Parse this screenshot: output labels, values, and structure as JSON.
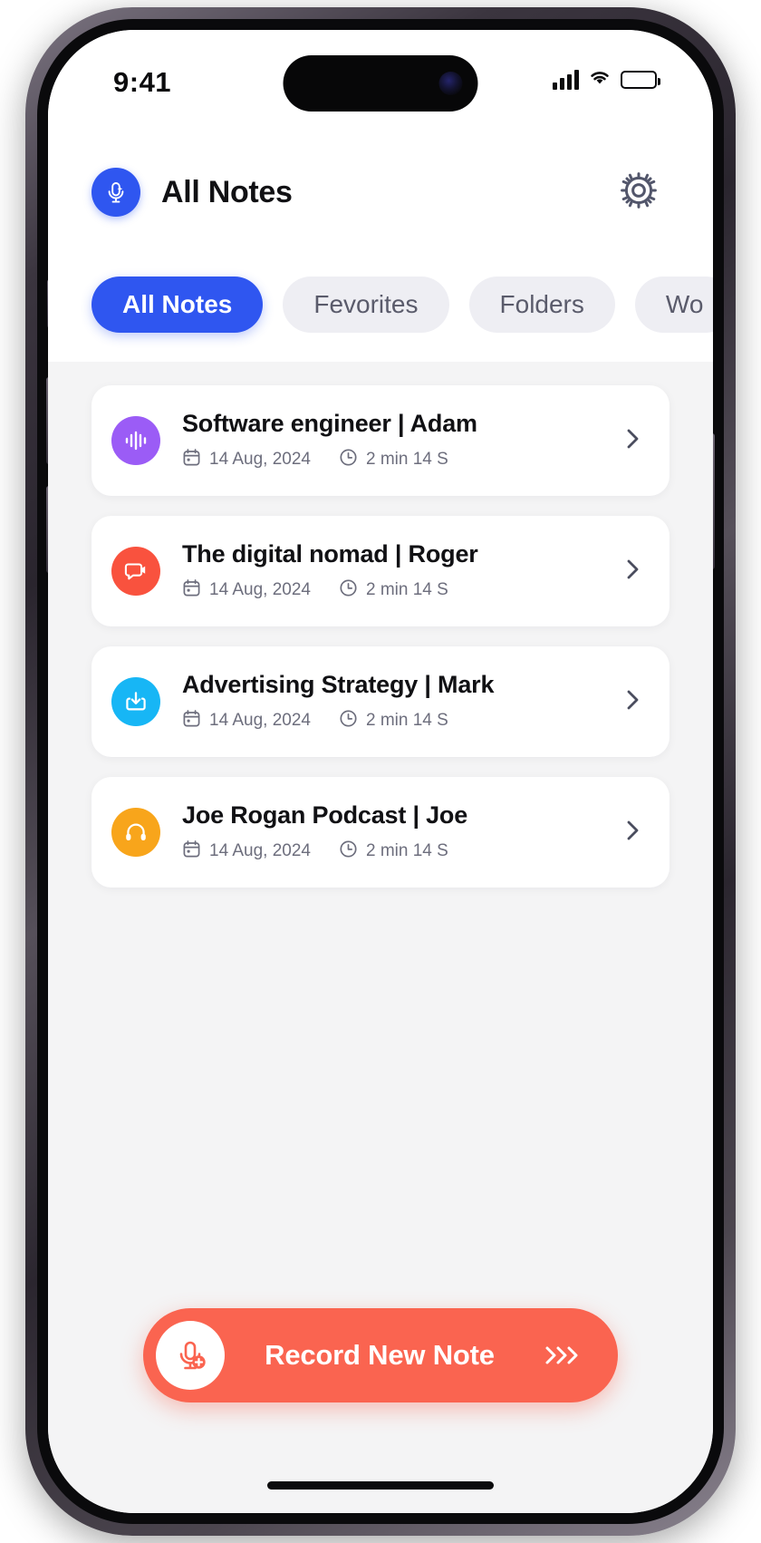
{
  "status_bar": {
    "time": "9:41",
    "signal_icon": "cellular-signal-icon",
    "wifi_icon": "wifi-icon",
    "battery_icon": "battery-full-icon"
  },
  "header": {
    "app_icon": "microphone-sparkle-icon",
    "app_icon_color": "#2F56F0",
    "title": "All Notes",
    "settings_icon": "gear-icon"
  },
  "tabs": [
    {
      "label": "All Notes",
      "active": true
    },
    {
      "label": "Fevorites",
      "active": false
    },
    {
      "label": "Folders",
      "active": false
    },
    {
      "label": "Wo",
      "active": false
    }
  ],
  "notes": [
    {
      "title": "Software engineer | Adam",
      "date": "14 Aug, 2024",
      "duration": "2 min 14 S",
      "icon": "audio-waveform-icon",
      "icon_color": "#9B5CF6",
      "chevron": "chevron-right-icon"
    },
    {
      "title": "The digital nomad | Roger",
      "date": "14 Aug, 2024",
      "duration": "2 min 14 S",
      "icon": "video-chat-bubble-icon",
      "icon_color": "#F9523E",
      "chevron": "chevron-right-icon"
    },
    {
      "title": "Advertising Strategy | Mark",
      "date": "14 Aug, 2024",
      "duration": "2 min 14 S",
      "icon": "import-download-icon",
      "icon_color": "#17B6F5",
      "chevron": "chevron-right-icon"
    },
    {
      "title": "Joe Rogan Podcast | Joe",
      "date": "14 Aug, 2024",
      "duration": "2 min 14 S",
      "icon": "headphones-icon",
      "icon_color": "#F8A51B",
      "chevron": "chevron-right-icon"
    }
  ],
  "meta_icons": {
    "date_icon": "calendar-icon",
    "duration_icon": "clock-icon"
  },
  "record_button": {
    "label": "Record New Note",
    "mic_icon": "microphone-plus-icon",
    "arrows": "›››",
    "color": "#FA6450"
  },
  "theme": {
    "accent_blue": "#2F56F0",
    "accent_red": "#FA6450",
    "screen_bg": "#F4F4F5",
    "card_bg": "#FFFFFF",
    "text_primary": "#111114",
    "text_muted": "#6D6E7D",
    "chip_bg": "#EEEEF3"
  }
}
